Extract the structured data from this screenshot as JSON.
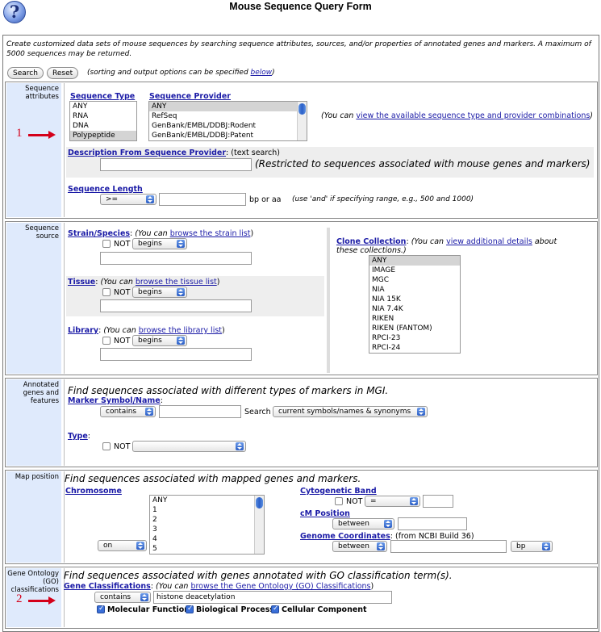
{
  "page": {
    "title": "Mouse Sequence Query Form",
    "help_icon": "?"
  },
  "intro": {
    "text": "Create customized data sets of mouse sequences by searching sequence attributes, sources, and/or properties of annotated genes and markers. A maximum of 5000 sequences may be returned.",
    "search_label": "Search",
    "reset_label": "Reset",
    "sorting_pre": "(sorting and output options can be specified ",
    "sorting_link": "below",
    "sorting_post": ")"
  },
  "attributes": {
    "label": "Sequence attributes",
    "marker": "1",
    "seq_type_label": "Sequence Type",
    "seq_type_options": [
      "ANY",
      "RNA",
      "DNA",
      "Polypeptide"
    ],
    "seq_type_selected": "Polypeptide",
    "provider_label": "Sequence Provider",
    "provider_options": [
      "ANY",
      "RefSeq",
      "GenBank/EMBL/DDBJ:Rodent",
      "GenBank/EMBL/DDBJ:Patent"
    ],
    "provider_selected": "ANY",
    "you_can": "(You can ",
    "combo_link": "view the available sequence type and provider combinations",
    "combo_post": ")",
    "desc_label": "Description From Sequence Provider",
    "desc_hint": ": (text search)",
    "desc_note": "(Restricted to sequences associated with mouse genes and markers)",
    "length_label": "Sequence Length",
    "length_op": ">=",
    "length_unit": "bp or aa",
    "length_hint": "(use 'and' if specifying range, e.g., 500 and 1000)"
  },
  "source": {
    "label": "Sequence source",
    "strain_label": "Strain/Species",
    "strain_pre": "(You can ",
    "strain_link": "browse the strain list",
    "tissue_label": "Tissue",
    "tissue_link": "browse the tissue list",
    "library_label": "Library",
    "library_link": "browse the library list",
    "not": "NOT",
    "begins": "begins",
    "clone_label": "Clone Collection",
    "clone_pre": "(You can ",
    "clone_link": "view additional details",
    "clone_post": " about these collections.)",
    "clone_options": [
      "ANY",
      "IMAGE",
      "MGC",
      "NIA",
      "NIA 15K",
      "NIA 7.4K",
      "RIKEN",
      "RIKEN (FANTOM)",
      "RPCI-23",
      "RPCI-24"
    ]
  },
  "annotated": {
    "label": "Annotated genes and features",
    "heading": "Find sequences associated with different types of markers in MGI.",
    "marker_label": "Marker Symbol/Name",
    "contains": "contains",
    "search_word": "Search",
    "scope": "current symbols/names & synonyms",
    "type_label": "Type",
    "not": "NOT"
  },
  "map": {
    "label": "Map position",
    "heading": "Find sequences associated with mapped genes and markers.",
    "chrom_label": "Chromosome",
    "chrom_options": [
      "ANY",
      "1",
      "2",
      "3",
      "4",
      "5"
    ],
    "chrom_op": "on",
    "cyto_label": "Cytogenetic Band",
    "not": "NOT",
    "eq": "=",
    "cm_label": "cM Position",
    "between": "between",
    "genome_label": "Genome Coordinates",
    "genome_hint": ": (from NCBI Build 36)",
    "unit": "bp"
  },
  "go": {
    "label": "Gene Ontology (GO) classifications",
    "marker": "2",
    "heading": "Find sequences associated with genes annotated with GO classification term(s).",
    "class_label": "Gene Classifications",
    "you_can": "(You can ",
    "go_link": "browse the Gene Ontology (GO) Classifications",
    "contains": "contains",
    "value": "histone deacetylation",
    "mf": "Molecular Function",
    "bp": "Biological Process",
    "cc": "Cellular Component"
  }
}
